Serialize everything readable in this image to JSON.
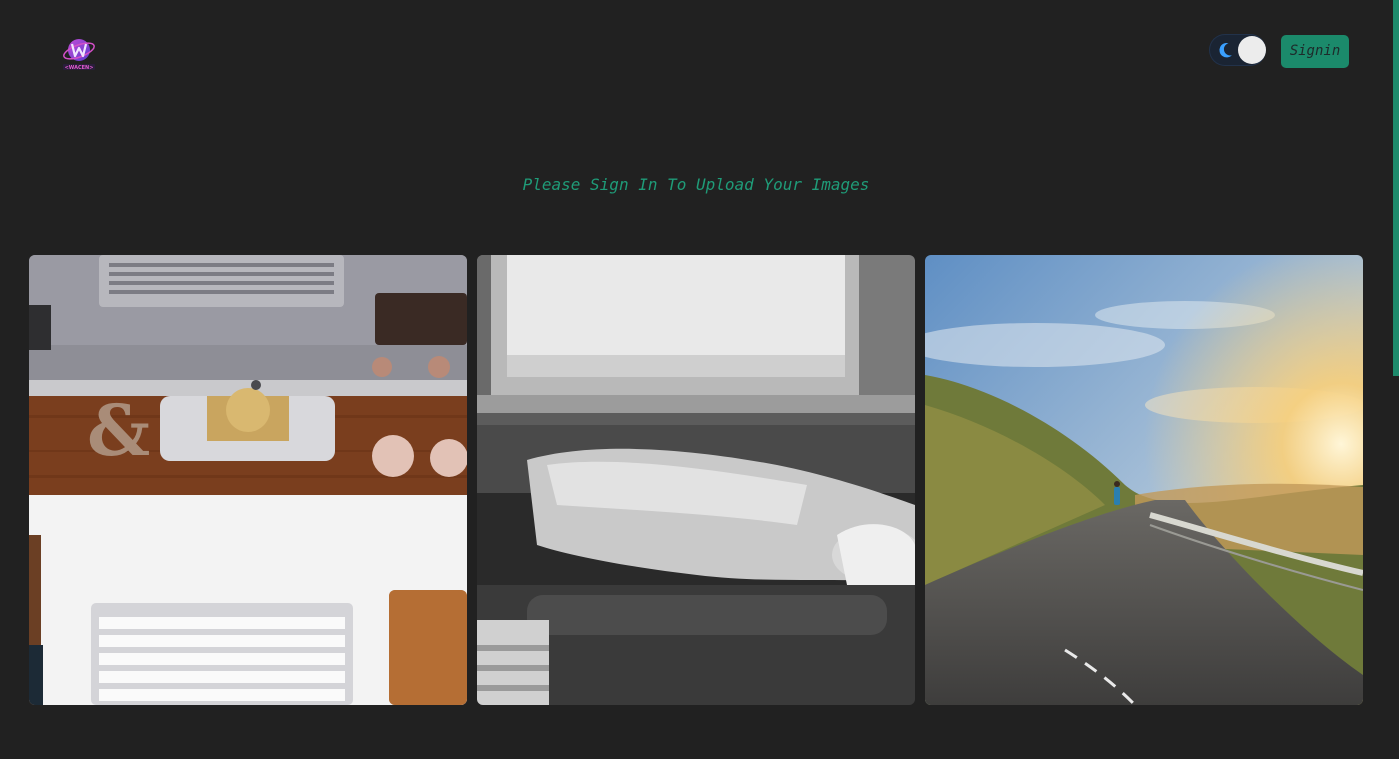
{
  "header": {
    "logo_text": "<WACEN>",
    "theme_toggle": {
      "icon": "moon-icon",
      "state": "dark"
    },
    "signin_label": "Signin"
  },
  "main": {
    "prompt": "Please Sign In To Upload Your Images"
  },
  "gallery": {
    "images": [
      {
        "icon": "desk-workspace-photo"
      },
      {
        "icon": "sleeping-woman-bw-photo"
      },
      {
        "icon": "coastal-road-sunset-photo"
      }
    ]
  },
  "colors": {
    "background": "#212121",
    "accent": "#1b8a6b",
    "prompt_text": "#1f9b78",
    "toggle_bg": "#1a2433"
  }
}
